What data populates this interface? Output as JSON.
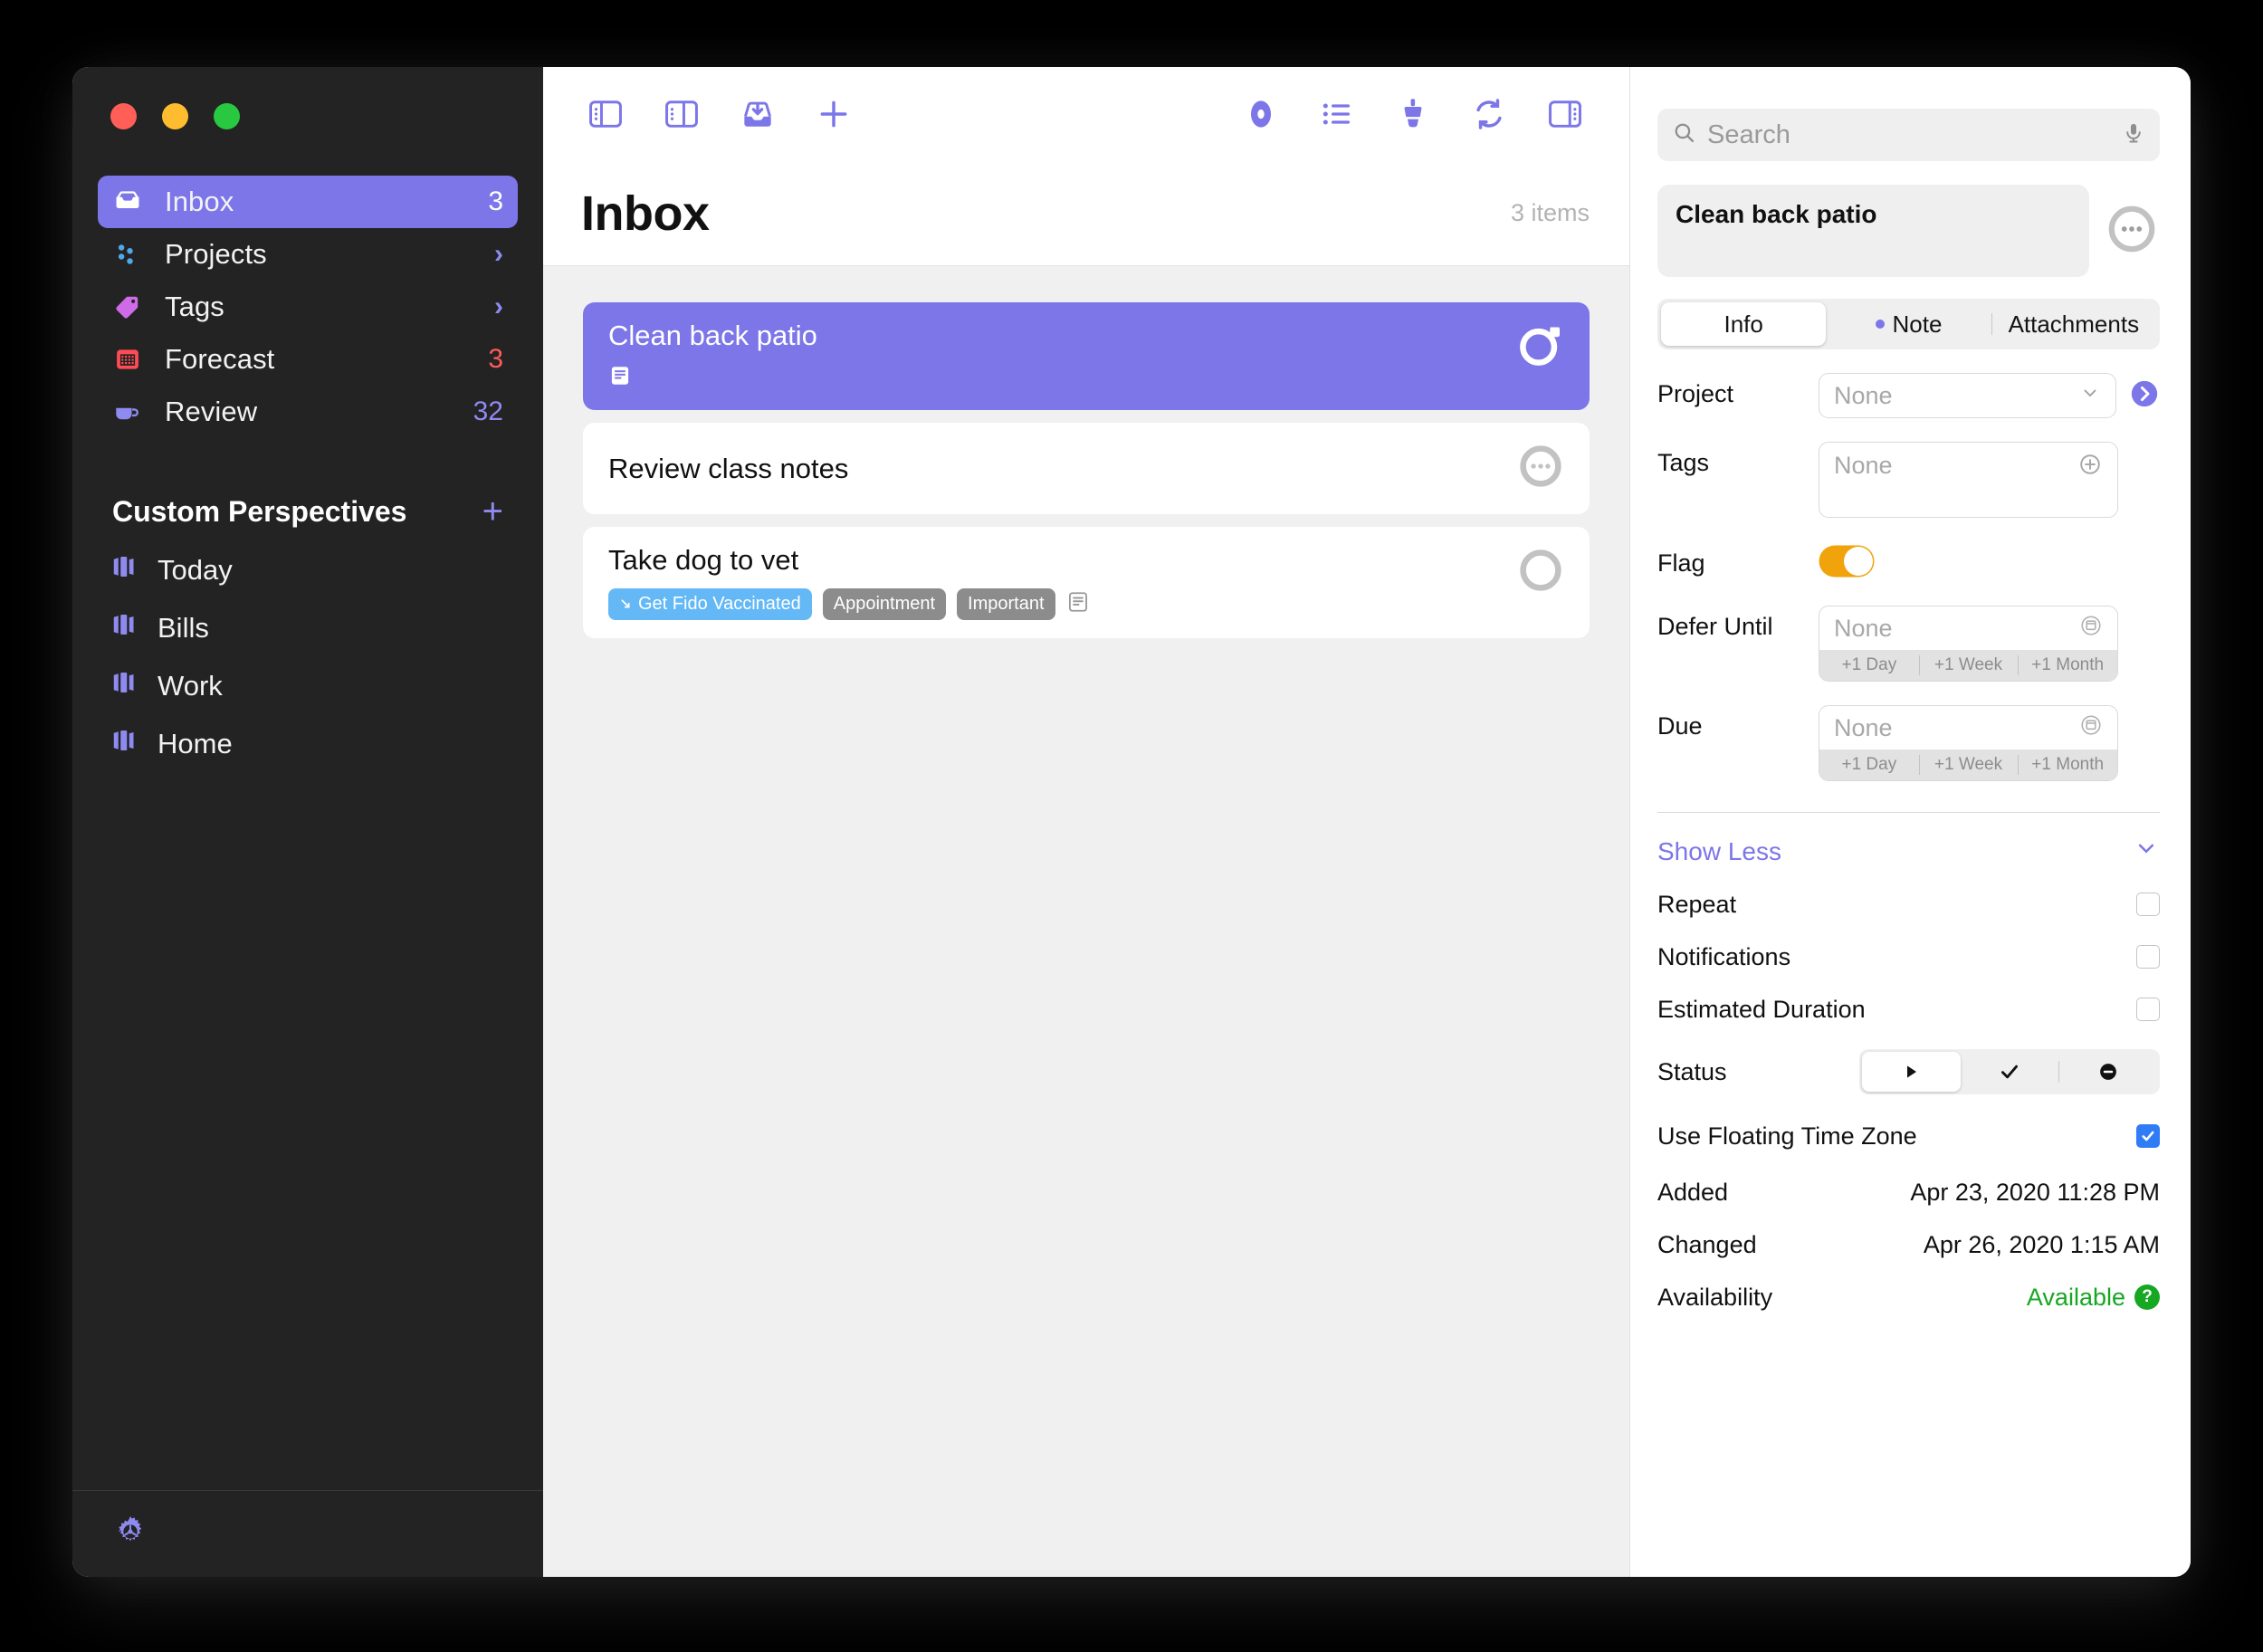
{
  "window": {
    "traffic_lights": [
      "close",
      "minimize",
      "zoom"
    ],
    "colors": {
      "accent_purple": "#7C76E8",
      "sidebar_bg": "#232323",
      "list_bg": "#F0F0F0",
      "flag_orange": "#F0A30A",
      "available_green": "#16A723",
      "tag_blue": "#64B8F5",
      "tag_gray": "#8C8C8C",
      "forecast_red": "#FF5A5A"
    }
  },
  "sidebar": {
    "items": [
      {
        "label": "Inbox",
        "icon": "inbox-icon",
        "count": "3",
        "count_color": "white",
        "selected": true,
        "chevron": false
      },
      {
        "label": "Projects",
        "icon": "projects-icon",
        "count": "",
        "count_color": "purple",
        "selected": false,
        "chevron": true
      },
      {
        "label": "Tags",
        "icon": "tag-icon",
        "count": "",
        "count_color": "purple",
        "selected": false,
        "chevron": true
      },
      {
        "label": "Forecast",
        "icon": "calendar-icon",
        "count": "3",
        "count_color": "red",
        "selected": false,
        "chevron": false
      },
      {
        "label": "Review",
        "icon": "coffee-icon",
        "count": "32",
        "count_color": "purple",
        "selected": false,
        "chevron": false
      }
    ],
    "custom_perspectives": {
      "title": "Custom Perspectives",
      "add_label": "+",
      "items": [
        {
          "label": "Today",
          "icon": "perspective-icon"
        },
        {
          "label": "Bills",
          "icon": "perspective-icon"
        },
        {
          "label": "Work",
          "icon": "perspective-icon"
        },
        {
          "label": "Home",
          "icon": "perspective-icon"
        }
      ]
    },
    "footer": {
      "settings_icon": "gear-icon"
    }
  },
  "toolbar": {
    "left_buttons": [
      {
        "name": "toggle-sidebar-left-icon"
      },
      {
        "name": "toggle-sidebar-right-icon"
      },
      {
        "name": "quick-entry-inbox-icon"
      },
      {
        "name": "add-item-icon"
      }
    ],
    "right_buttons": [
      {
        "name": "view-options-eye-icon"
      },
      {
        "name": "list-layout-icon"
      },
      {
        "name": "paintbrush-styles-icon"
      },
      {
        "name": "sync-icon"
      },
      {
        "name": "toggle-inspector-icon"
      }
    ]
  },
  "main": {
    "title": "Inbox",
    "item_count": "3 items",
    "tasks": [
      {
        "name": "Clean back patio",
        "selected": true,
        "status_icon": "flagged-circle-icon",
        "has_note": true,
        "tags": []
      },
      {
        "name": "Review class notes",
        "selected": false,
        "status_icon": "ellipsis-circle-icon",
        "has_note": false,
        "tags": []
      },
      {
        "name": "Take dog to vet",
        "selected": false,
        "status_icon": "empty-circle-icon",
        "has_note": true,
        "tags": [
          {
            "label": "Get Fido Vaccinated",
            "color": "blue",
            "icon": "project-arrow-icon"
          },
          {
            "label": "Appointment",
            "color": "gray",
            "icon": ""
          },
          {
            "label": "Important",
            "color": "gray",
            "icon": ""
          }
        ]
      }
    ]
  },
  "inspector": {
    "search": {
      "placeholder": "Search",
      "value": "",
      "icon": "search-icon",
      "mic_icon": "microphone-icon"
    },
    "item_title": "Clean back patio",
    "more_button_icon": "ellipsis-circle-icon",
    "tabs": [
      {
        "label": "Info",
        "active": true,
        "dot": false
      },
      {
        "label": "Note",
        "active": false,
        "dot": true
      },
      {
        "label": "Attachments",
        "active": false,
        "dot": false
      }
    ],
    "fields": {
      "project": {
        "label": "Project",
        "value": "None",
        "chevron_icon": "chevron-down-icon",
        "go_icon": "go-to-project-icon"
      },
      "tags": {
        "label": "Tags",
        "value": "None",
        "add_icon": "plus-circle-icon"
      },
      "flag": {
        "label": "Flag",
        "on": true
      },
      "defer": {
        "label": "Defer Until",
        "value": "None",
        "calendar_icon": "calendar-icon",
        "quick": [
          "+1 Day",
          "+1 Week",
          "+1 Month"
        ]
      },
      "due": {
        "label": "Due",
        "value": "None",
        "calendar_icon": "calendar-icon",
        "quick": [
          "+1 Day",
          "+1 Week",
          "+1 Month"
        ]
      }
    },
    "show_less": {
      "label": "Show Less",
      "chevron_icon": "chevron-down-icon"
    },
    "extra_rows": [
      {
        "label": "Repeat",
        "checked": false
      },
      {
        "label": "Notifications",
        "checked": false
      },
      {
        "label": "Estimated Duration",
        "checked": false
      }
    ],
    "status": {
      "label": "Status",
      "options": [
        {
          "icon": "play-icon",
          "active": true
        },
        {
          "icon": "checkmark-icon",
          "active": false
        },
        {
          "icon": "minus-circle-icon",
          "active": false
        }
      ]
    },
    "floating_tz": {
      "label": "Use Floating Time Zone",
      "checked": true
    },
    "added": {
      "label": "Added",
      "value": "Apr 23, 2020 11:28 PM"
    },
    "changed": {
      "label": "Changed",
      "value": "Apr 26, 2020 1:15 AM"
    },
    "availability": {
      "label": "Availability",
      "value": "Available",
      "help_icon": "help-icon"
    }
  }
}
